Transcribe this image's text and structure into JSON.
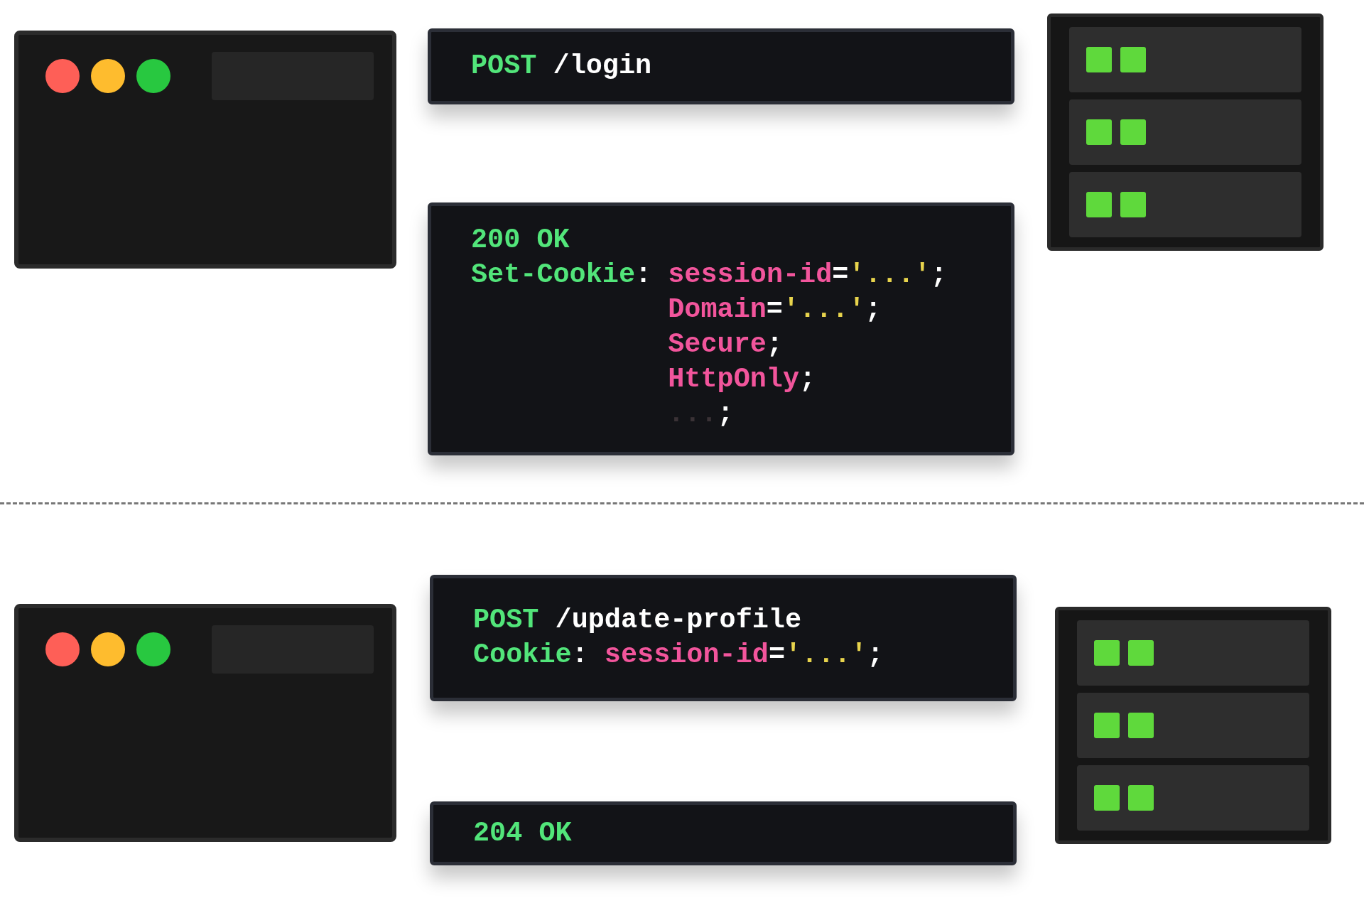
{
  "sections": [
    {
      "browser": {
        "window_buttons": [
          {
            "color": "#fe5f57"
          },
          {
            "color": "#febc2e"
          },
          {
            "color": "#28c840"
          }
        ]
      },
      "request": {
        "lines": [
          {
            "indent": false,
            "tokens": [
              {
                "kind": "keyword",
                "text": "POST"
              },
              {
                "kind": "plain",
                "text": " /login"
              }
            ]
          }
        ]
      },
      "response": {
        "lines": [
          {
            "indent": false,
            "tokens": [
              {
                "kind": "keyword",
                "text": "200 OK"
              }
            ]
          },
          {
            "indent": false,
            "tokens": [
              {
                "kind": "keyword",
                "text": "Set-Cookie"
              },
              {
                "kind": "plain",
                "text": ": "
              },
              {
                "kind": "attr",
                "text": "session-id"
              },
              {
                "kind": "plain",
                "text": "="
              },
              {
                "kind": "string",
                "text": "'...'"
              },
              {
                "kind": "plain",
                "text": ";"
              }
            ]
          },
          {
            "indent": true,
            "tokens": [
              {
                "kind": "attr",
                "text": "Domain"
              },
              {
                "kind": "plain",
                "text": "="
              },
              {
                "kind": "string",
                "text": "'...'"
              },
              {
                "kind": "plain",
                "text": ";"
              }
            ]
          },
          {
            "indent": true,
            "tokens": [
              {
                "kind": "attr",
                "text": "Secure"
              },
              {
                "kind": "plain",
                "text": ";"
              }
            ]
          },
          {
            "indent": true,
            "tokens": [
              {
                "kind": "attr",
                "text": "HttpOnly"
              },
              {
                "kind": "plain",
                "text": ";"
              }
            ]
          },
          {
            "indent": true,
            "tokens": [
              {
                "kind": "muted",
                "text": "..."
              },
              {
                "kind": "plain",
                "text": ";"
              }
            ]
          }
        ]
      }
    },
    {
      "browser": {
        "window_buttons": [
          {
            "color": "#fe5f57"
          },
          {
            "color": "#febc2e"
          },
          {
            "color": "#28c840"
          }
        ]
      },
      "request": {
        "lines": [
          {
            "indent": false,
            "tokens": [
              {
                "kind": "keyword",
                "text": "POST"
              },
              {
                "kind": "plain",
                "text": " /update-profile"
              }
            ]
          },
          {
            "indent": false,
            "tokens": [
              {
                "kind": "keyword",
                "text": "Cookie"
              },
              {
                "kind": "plain",
                "text": ": "
              },
              {
                "kind": "attr",
                "text": "session-id"
              },
              {
                "kind": "plain",
                "text": "="
              },
              {
                "kind": "string",
                "text": "'...'"
              },
              {
                "kind": "plain",
                "text": ";"
              }
            ]
          }
        ]
      },
      "response": {
        "lines": [
          {
            "indent": false,
            "tokens": [
              {
                "kind": "keyword",
                "text": "204 OK"
              }
            ]
          }
        ]
      }
    }
  ]
}
